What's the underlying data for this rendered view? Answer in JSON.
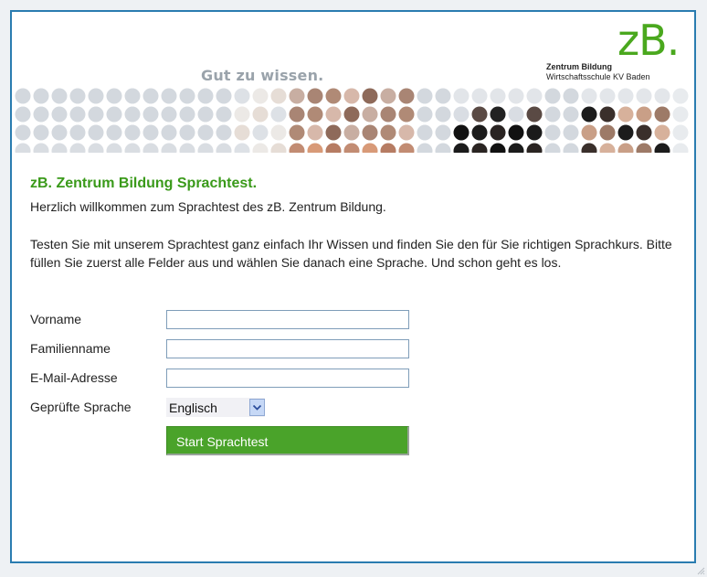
{
  "header": {
    "tagline": "Gut zu wissen.",
    "logo_mark": "zB.",
    "logo_line1": "Zentrum Bildung",
    "logo_line2": "Wirtschaftsschule KV Baden"
  },
  "main": {
    "title": "zB. Zentrum Bildung Sprachtest.",
    "welcome": "Herzlich willkommen zum Sprachtest des zB. Zentrum Bildung.",
    "intro": "Testen Sie mit unserem Sprachtest ganz einfach Ihr Wissen und finden Sie den für Sie richtigen Sprachkurs. Bitte füllen Sie zuerst alle Felder aus und wählen Sie danach eine Sprache. Und schon geht es los."
  },
  "form": {
    "first_name_label": "Vorname",
    "first_name_value": "",
    "last_name_label": "Familienname",
    "last_name_value": "",
    "email_label": "E-Mail-Adresse",
    "email_value": "",
    "language_label": "Geprüfte Sprache",
    "language_selected": "Englisch",
    "submit_label": "Start Sprachtest"
  },
  "colors": {
    "brand_green": "#4aa81e",
    "frame_border": "#2a7cb0",
    "button_green": "#4aa32a"
  }
}
